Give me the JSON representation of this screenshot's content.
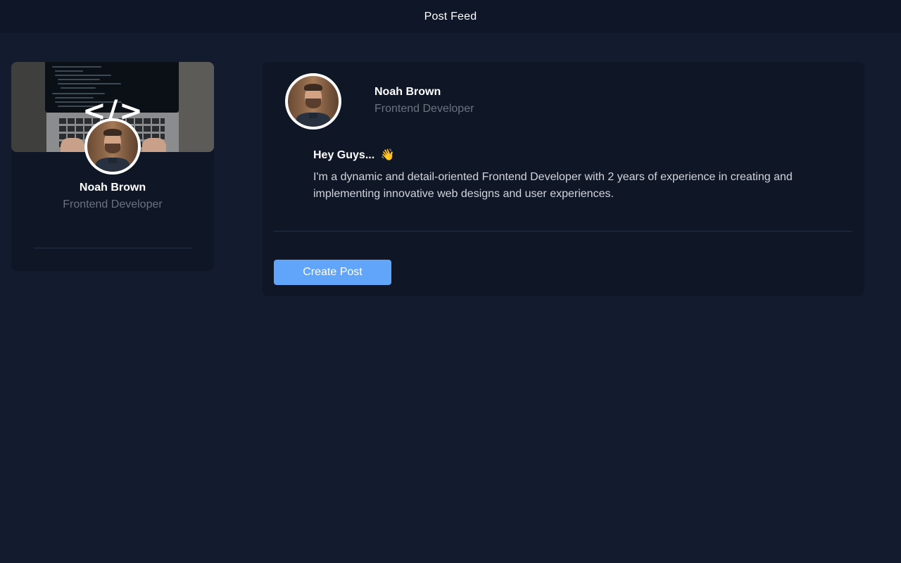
{
  "header": {
    "title": "Post Feed"
  },
  "profile": {
    "name": "Noah Brown",
    "role": "Frontend Developer",
    "cover_icon": "code-brackets-icon",
    "cover_glyph": "</>"
  },
  "post": {
    "author_name": "Noah Brown",
    "author_role": "Frontend Developer",
    "heading": "Hey Guys...",
    "heading_emoji": "👋",
    "body": "I'm a dynamic and detail-oriented Frontend Developer with 2 years of experience in creating and implementing innovative web designs and user experiences.",
    "create_label": "Create Post"
  },
  "colors": {
    "background": "#131b2e",
    "card": "#0f1626",
    "accent": "#60a5fa",
    "muted_text": "#6b7280"
  }
}
